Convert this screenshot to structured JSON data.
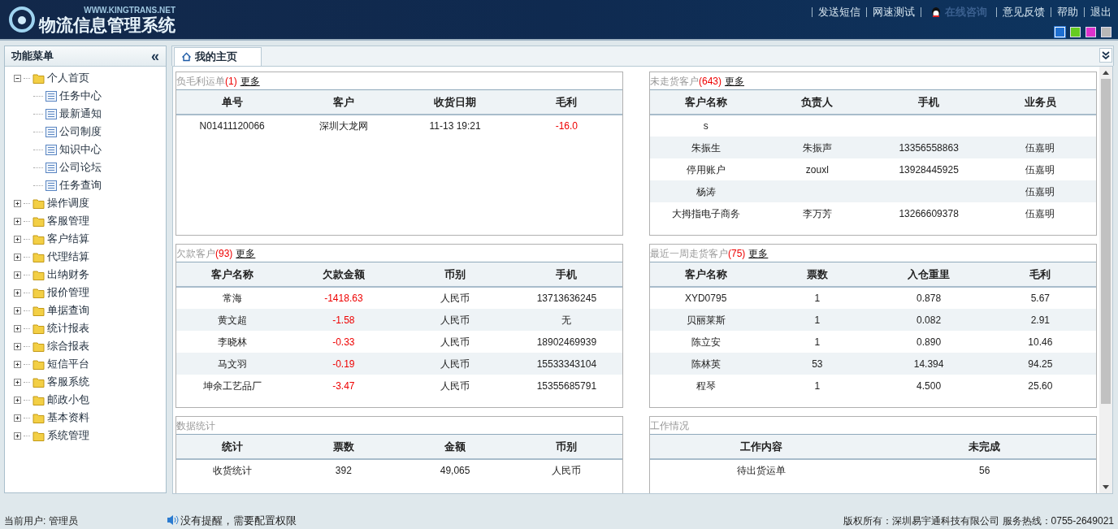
{
  "header": {
    "site_url": "WWW.KINGTRANS.NET",
    "app_title": "物流信息管理系统",
    "links": [
      {
        "kind": "link",
        "label": "发送短信"
      },
      {
        "kind": "link",
        "label": "网速测试"
      },
      {
        "kind": "qq",
        "label": "在线咨询"
      },
      {
        "kind": "link",
        "label": "意见反馈"
      },
      {
        "kind": "link",
        "label": "帮助"
      },
      {
        "kind": "link",
        "label": "退出"
      }
    ],
    "themes": [
      {
        "color": "#1e6fd0",
        "selected": true
      },
      {
        "color": "#66cc22",
        "selected": false
      },
      {
        "color": "#dd33cc",
        "selected": false
      },
      {
        "color": "#b8b8b8",
        "selected": false
      }
    ]
  },
  "sidebar": {
    "title": "功能菜单",
    "collapse_icon": "«",
    "items": [
      {
        "label": "个人首页",
        "expanded": true,
        "children": [
          {
            "label": "任务中心"
          },
          {
            "label": "最新通知"
          },
          {
            "label": "公司制度"
          },
          {
            "label": "知识中心"
          },
          {
            "label": "公司论坛"
          },
          {
            "label": "任务查询"
          }
        ]
      },
      {
        "label": "操作调度",
        "expanded": false
      },
      {
        "label": "客服管理",
        "expanded": false
      },
      {
        "label": "客户结算",
        "expanded": false
      },
      {
        "label": "代理结算",
        "expanded": false
      },
      {
        "label": "出纳财务",
        "expanded": false
      },
      {
        "label": "报价管理",
        "expanded": false
      },
      {
        "label": "单据查询",
        "expanded": false
      },
      {
        "label": "统计报表",
        "expanded": false
      },
      {
        "label": "综合报表",
        "expanded": false
      },
      {
        "label": "短信平台",
        "expanded": false
      },
      {
        "label": "客服系统",
        "expanded": false
      },
      {
        "label": "邮政小包",
        "expanded": false
      },
      {
        "label": "基本资料",
        "expanded": false
      },
      {
        "label": "系统管理",
        "expanded": false
      }
    ]
  },
  "tabs": [
    {
      "label": "我的主页",
      "selected": true
    }
  ],
  "panels": [
    {
      "title": "负毛利运单",
      "count": "(1)",
      "more": "更多",
      "columns": [
        {
          "label": "单号",
          "red": false
        },
        {
          "label": "客户",
          "red": false
        },
        {
          "label": "收货日期",
          "red": false
        },
        {
          "label": "毛利",
          "red": true
        }
      ],
      "rows": [
        [
          "N01411120066",
          "深圳大龙网",
          "11-13 19:21",
          "-16.0"
        ]
      ]
    },
    {
      "title": "未走货客户",
      "count": "(643)",
      "more": "更多",
      "columns": [
        {
          "label": "客户名称",
          "red": false
        },
        {
          "label": "负责人",
          "red": false
        },
        {
          "label": "手机",
          "red": false
        },
        {
          "label": "业务员",
          "red": false
        }
      ],
      "rows": [
        [
          "s",
          "",
          "",
          ""
        ],
        [
          "朱振生",
          "朱振声",
          "13356558863",
          "伍嘉明"
        ],
        [
          "停用账户",
          "zouxl",
          "13928445925",
          "伍嘉明"
        ],
        [
          "杨涛",
          "",
          "",
          "伍嘉明"
        ],
        [
          "大拇指电子商务",
          "李万芳",
          "13266609378",
          "伍嘉明"
        ]
      ]
    },
    {
      "title": "欠款客户",
      "count": "(93)",
      "more": "更多",
      "columns": [
        {
          "label": "客户名称",
          "red": false
        },
        {
          "label": "欠款金额",
          "red": true
        },
        {
          "label": "币别",
          "red": false
        },
        {
          "label": "手机",
          "red": false
        }
      ],
      "rows": [
        [
          "常海",
          "-1418.63",
          "人民币",
          "13713636245"
        ],
        [
          "黄文超",
          "-1.58",
          "人民币",
          "无"
        ],
        [
          "李晓林",
          "-0.33",
          "人民币",
          "18902469939"
        ],
        [
          "马文羽",
          "-0.19",
          "人民币",
          "15533343104"
        ],
        [
          "坤余工艺品厂",
          "-3.47",
          "人民币",
          "15355685791"
        ]
      ]
    },
    {
      "title": "最近一周走货客户",
      "count": "(75)",
      "more": "更多",
      "columns": [
        {
          "label": "客户名称",
          "red": false
        },
        {
          "label": "票数",
          "red": false
        },
        {
          "label": "入仓重里",
          "red": false
        },
        {
          "label": "毛利",
          "red": false
        }
      ],
      "rows": [
        [
          "XYD0795",
          "1",
          "0.878",
          "5.67"
        ],
        [
          "贝丽莱斯",
          "1",
          "0.082",
          "2.91"
        ],
        [
          "陈立安",
          "1",
          "0.890",
          "10.46"
        ],
        [
          "陈林英",
          "53",
          "14.394",
          "94.25"
        ],
        [
          "程琴",
          "1",
          "4.500",
          "25.60"
        ]
      ]
    },
    {
      "title": "数据统计",
      "columns": [
        {
          "label": "统计",
          "red": false
        },
        {
          "label": "票数",
          "red": false
        },
        {
          "label": "金额",
          "red": false
        },
        {
          "label": "币别",
          "red": false
        }
      ],
      "rows": [
        [
          "收货统计",
          "392",
          "49,065",
          "人民币"
        ]
      ]
    },
    {
      "title": "工作情况",
      "columns": [
        {
          "label": "工作内容",
          "red": false
        },
        {
          "label": "未完成",
          "red": false
        }
      ],
      "rows": [
        [
          "待出货运单",
          "56"
        ]
      ]
    }
  ],
  "status_bar": {
    "user_label": "当前用户:",
    "user": "管理员",
    "notice": "没有提醒，需要配置权限",
    "copyright": "版权所有：深圳易宇通科技有限公司 服务热线：0755-2649021"
  }
}
